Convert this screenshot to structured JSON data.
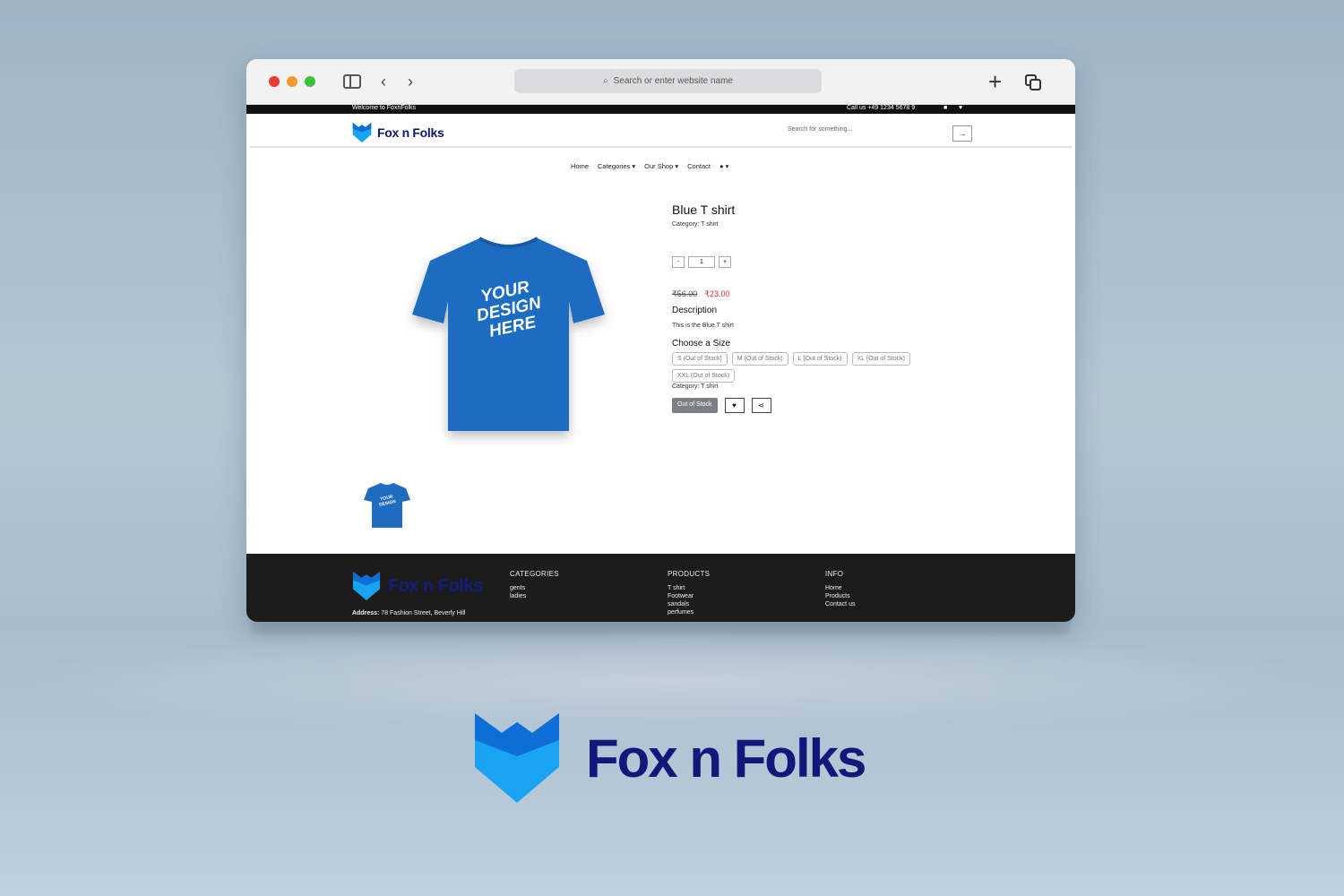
{
  "browser": {
    "address_placeholder": "Search or enter website name"
  },
  "site": {
    "topbar": {
      "welcome": "Welcome to FoxnFolks",
      "call": "Call us +49 1234 5678 9"
    },
    "brand": "Fox n Folks",
    "search_placeholder": "Search for something...",
    "menu": {
      "home": "Home",
      "categories": "Categories",
      "our_shop": "Our Shop",
      "contact": "Contact"
    },
    "product": {
      "title": "Blue T shirt",
      "category_line": "Category: T shirt",
      "quantity": "1",
      "minus": "-",
      "plus": "+",
      "old_price": "₹56.00",
      "new_price": "₹23.00",
      "description_heading": "Description",
      "description": "This is the Blue T shirt",
      "size_heading": "Choose a Size",
      "sizes": [
        "S (Out of Stock)",
        "M (Out of Stock)",
        "L (Out of Stock)",
        "XL (Out of Stock)",
        "XXL (Out of Stock)"
      ],
      "category_line2": "Category: T shirt",
      "stock_button": "Out of Stock",
      "image_text": "YOUR DESIGN HERE"
    },
    "footer": {
      "brand": "Fox n Folks",
      "address_label": "Address:",
      "address": "78 Fashion Street, Beverly Hill",
      "categories": {
        "heading": "CATEGORIES",
        "items": [
          "gents",
          "ladies"
        ]
      },
      "products": {
        "heading": "PRODUCTS",
        "items": [
          "T shirt",
          "Footwear",
          "sandals",
          "perfumes"
        ]
      },
      "info": {
        "heading": "INFO",
        "items": [
          "Home",
          "Products",
          "Contact us"
        ]
      }
    }
  },
  "brand_large": "Fox n Folks",
  "colors": {
    "brand_navy": "#13177a",
    "brand_cyan": "#1aa3f0",
    "shirt_blue": "#1f6cc2",
    "price_red": "#e0322c"
  }
}
